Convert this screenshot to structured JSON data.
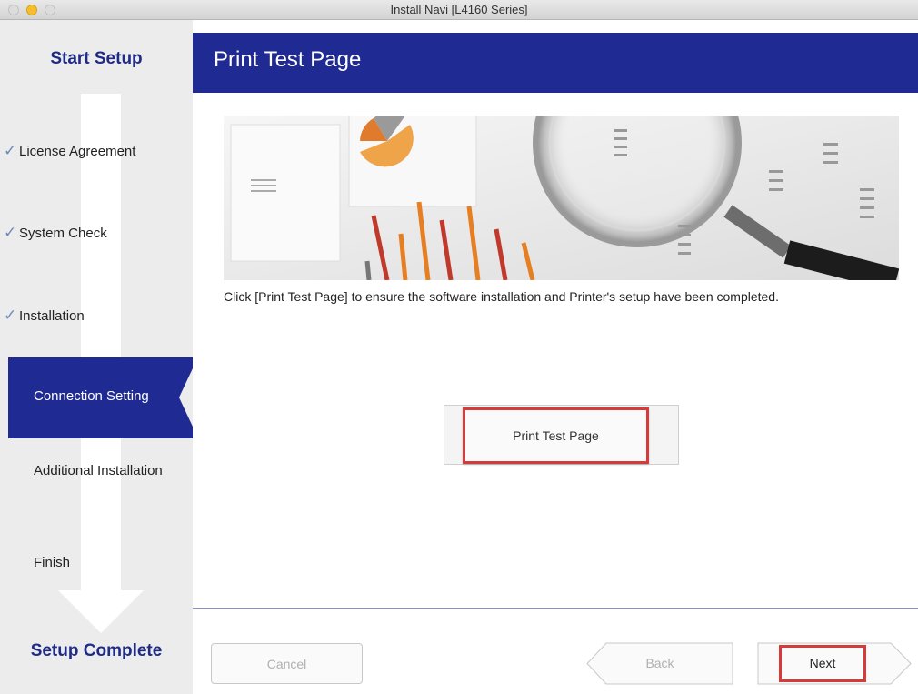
{
  "window": {
    "title": "Install Navi [L4160 Series]"
  },
  "sidebar": {
    "start_label": "Start Setup",
    "complete_label": "Setup Complete",
    "steps": [
      {
        "label": "License Agreement",
        "done": true
      },
      {
        "label": "System Check",
        "done": true
      },
      {
        "label": "Installation",
        "done": true
      },
      {
        "label": "Connection Setting",
        "active": true
      },
      {
        "label": "Additional Installation"
      },
      {
        "label": "Finish"
      }
    ]
  },
  "main": {
    "title": "Print Test Page",
    "instruction": "Click [Print Test Page] to ensure the software installation and Printer's setup have been completed.",
    "print_button": "Print Test Page"
  },
  "footer": {
    "cancel": "Cancel",
    "back": "Back",
    "next": "Next"
  },
  "colors": {
    "brand_blue": "#1f2b93",
    "highlight_red": "#d63b3b"
  }
}
